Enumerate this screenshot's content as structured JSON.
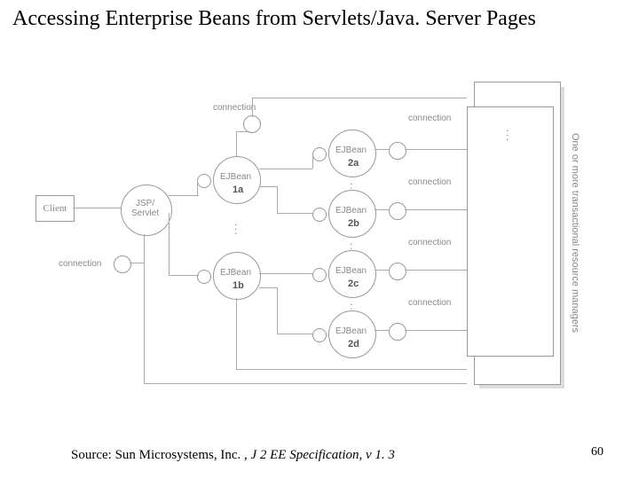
{
  "title": "Accessing Enterprise Beans from Servlets/Java. Server Pages",
  "source_prefix": "Source: Sun Microsystems, Inc. , ",
  "source_italic": "J 2 EE Specification, v 1. 3",
  "page_number": "60",
  "diagram": {
    "client": "Client",
    "jsp_servlet": "JSP/\nServlet",
    "ejbean": "EJBean",
    "connection": "connection",
    "labels": {
      "one_a": "1a",
      "one_b": "1b",
      "two_a": "2a",
      "two_b": "2b",
      "two_c": "2c",
      "two_d": "2d"
    },
    "side_text": "One or more transactional resource managers"
  }
}
